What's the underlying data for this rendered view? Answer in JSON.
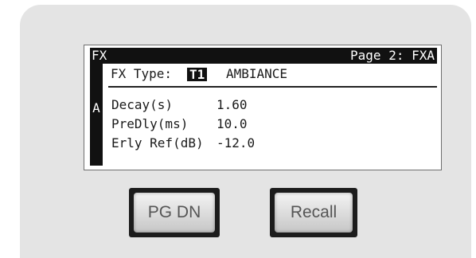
{
  "lcd": {
    "header_left": "FX",
    "header_right": "Page 2: FXA",
    "side_letter": "A",
    "fx_type_label": "FX Type:",
    "fx_type_slot": "T1",
    "fx_type_name": "AMBIANCE",
    "params": [
      {
        "name": "Decay(s)",
        "value": "1.60"
      },
      {
        "name": "PreDly(ms)",
        "value": "10.0"
      },
      {
        "name": "Erly Ref(dB)",
        "value": "-12.0"
      }
    ]
  },
  "buttons": {
    "pg_dn": "PG DN",
    "recall": "Recall"
  }
}
